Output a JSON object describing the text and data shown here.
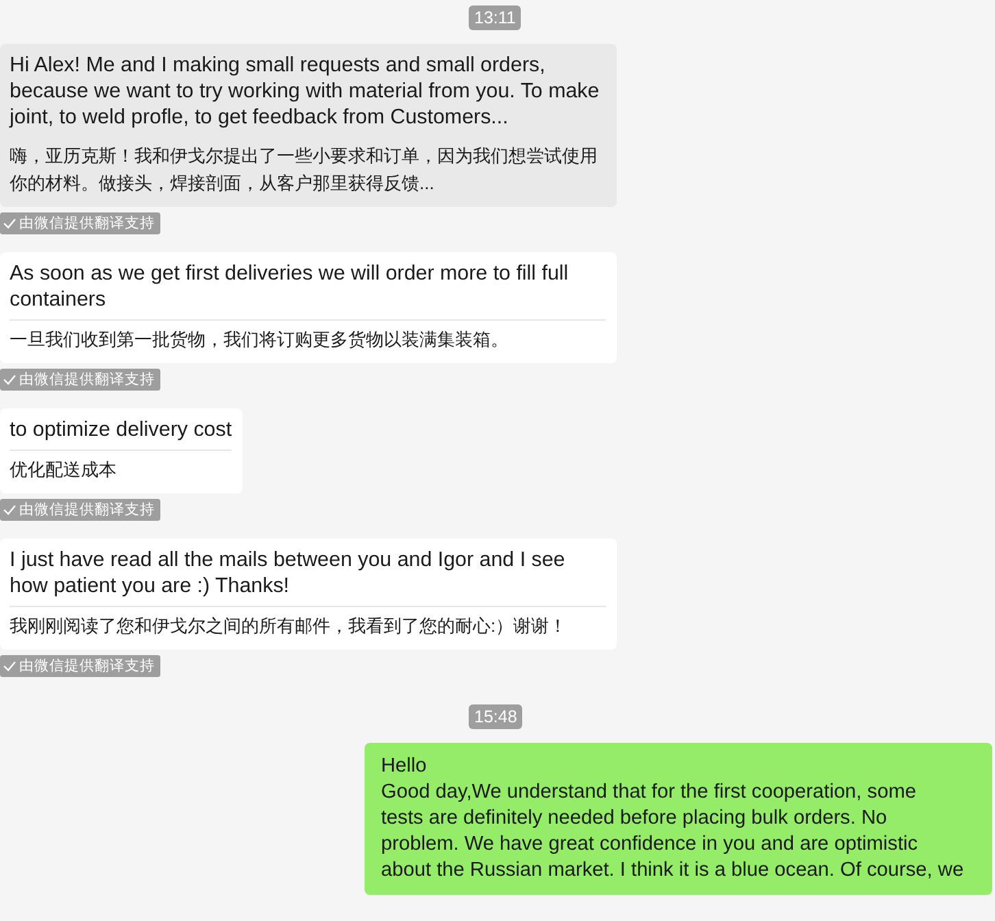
{
  "messages": [
    {
      "kind": "time",
      "text": "13:11"
    },
    {
      "kind": "received",
      "highlighted": true,
      "text": "Hi Alex! Me and I making small requests and small orders, because we want to try working with material from you. To make joint, to weld profle, to get feedback from Customers...",
      "translation": "嗨，亚历克斯！我和伊戈尔提出了一些小要求和订单，因为我们想尝试使用你的材料。做接头，焊接剖面，从客户那里获得反馈...",
      "divider": false,
      "badge": "由微信提供翻译支持"
    },
    {
      "kind": "received",
      "highlighted": false,
      "text": "As soon as we get first deliveries we will order more to fill full containers",
      "translation": "一旦我们收到第一批货物，我们将订购更多货物以装满集装箱。",
      "divider": true,
      "badge": "由微信提供翻译支持"
    },
    {
      "kind": "received",
      "highlighted": false,
      "text": "to optimize delivery cost",
      "translation": "优化配送成本",
      "divider": true,
      "badge": "由微信提供翻译支持"
    },
    {
      "kind": "received",
      "highlighted": false,
      "text": "I just have read all the mails between you and Igor and I see how patient you are :) Thanks!",
      "translation": "我刚刚阅读了您和伊戈尔之间的所有邮件，我看到了您的耐心:）谢谢！",
      "divider": true,
      "badge": "由微信提供翻译支持"
    },
    {
      "kind": "time",
      "text": "15:48"
    },
    {
      "kind": "sent",
      "lines": [
        "Hello",
        "Good day,We understand that for the first cooperation, some",
        "tests are definitely needed before placing bulk orders. No",
        "problem. We have great confidence in you and are optimistic",
        "about the Russian market. I think it is a blue ocean. Of course, we"
      ]
    }
  ]
}
